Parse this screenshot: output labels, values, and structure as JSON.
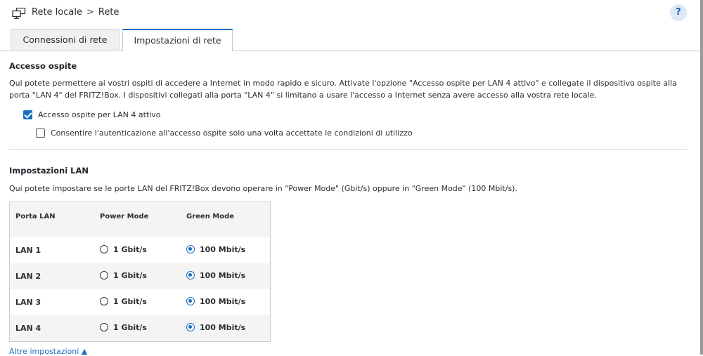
{
  "breadcrumb": {
    "parent": "Rete locale",
    "separator": ">",
    "current": "Rete"
  },
  "help": {
    "label": "?"
  },
  "tabs": [
    {
      "label": "Connessioni di rete",
      "active": false
    },
    {
      "label": "Impostazioni di rete",
      "active": true
    }
  ],
  "guest": {
    "title": "Accesso ospite",
    "description": "Qui potete permettere ai vostri ospiti di accedere a Internet in modo rapido e sicuro. Attivate l'opzione \"Accesso ospite per LAN 4 attivo\" e collegate il dispositivo ospite alla porta \"LAN 4\" del FRITZ!Box. I dispositivi collegati alla porta \"LAN 4\" si limitano a usare l'accesso a Internet senza avere accesso alla vostra rete locale.",
    "checkbox_guest": {
      "label": "Accesso ospite per LAN 4 attivo",
      "checked": true
    },
    "checkbox_auth": {
      "label": "Consentire l'autenticazione all'accesso ospite solo una volta accettate le condizioni di utilizzo",
      "checked": false
    }
  },
  "lan": {
    "title": "Impostazioni LAN",
    "description": "Qui potete impostare se le porte LAN del FRITZ!Box devono operare in \"Power Mode\" (Gbit/s) oppure in \"Green Mode\" (100 Mbit/s).",
    "columns": [
      "Porta LAN",
      "Power Mode",
      "Green Mode"
    ],
    "power_label": "1 Gbit/s",
    "green_label": "100 Mbit/s",
    "rows": [
      {
        "port": "LAN 1",
        "mode": "green"
      },
      {
        "port": "LAN 2",
        "mode": "green"
      },
      {
        "port": "LAN 3",
        "mode": "green"
      },
      {
        "port": "LAN 4",
        "mode": "green"
      }
    ]
  },
  "more_settings": {
    "label": "Altre impostazioni ▲"
  },
  "colors": {
    "accent": "#1a6ec1",
    "help_bg": "#dde8f7",
    "row_alt": "#f4f4f4"
  }
}
